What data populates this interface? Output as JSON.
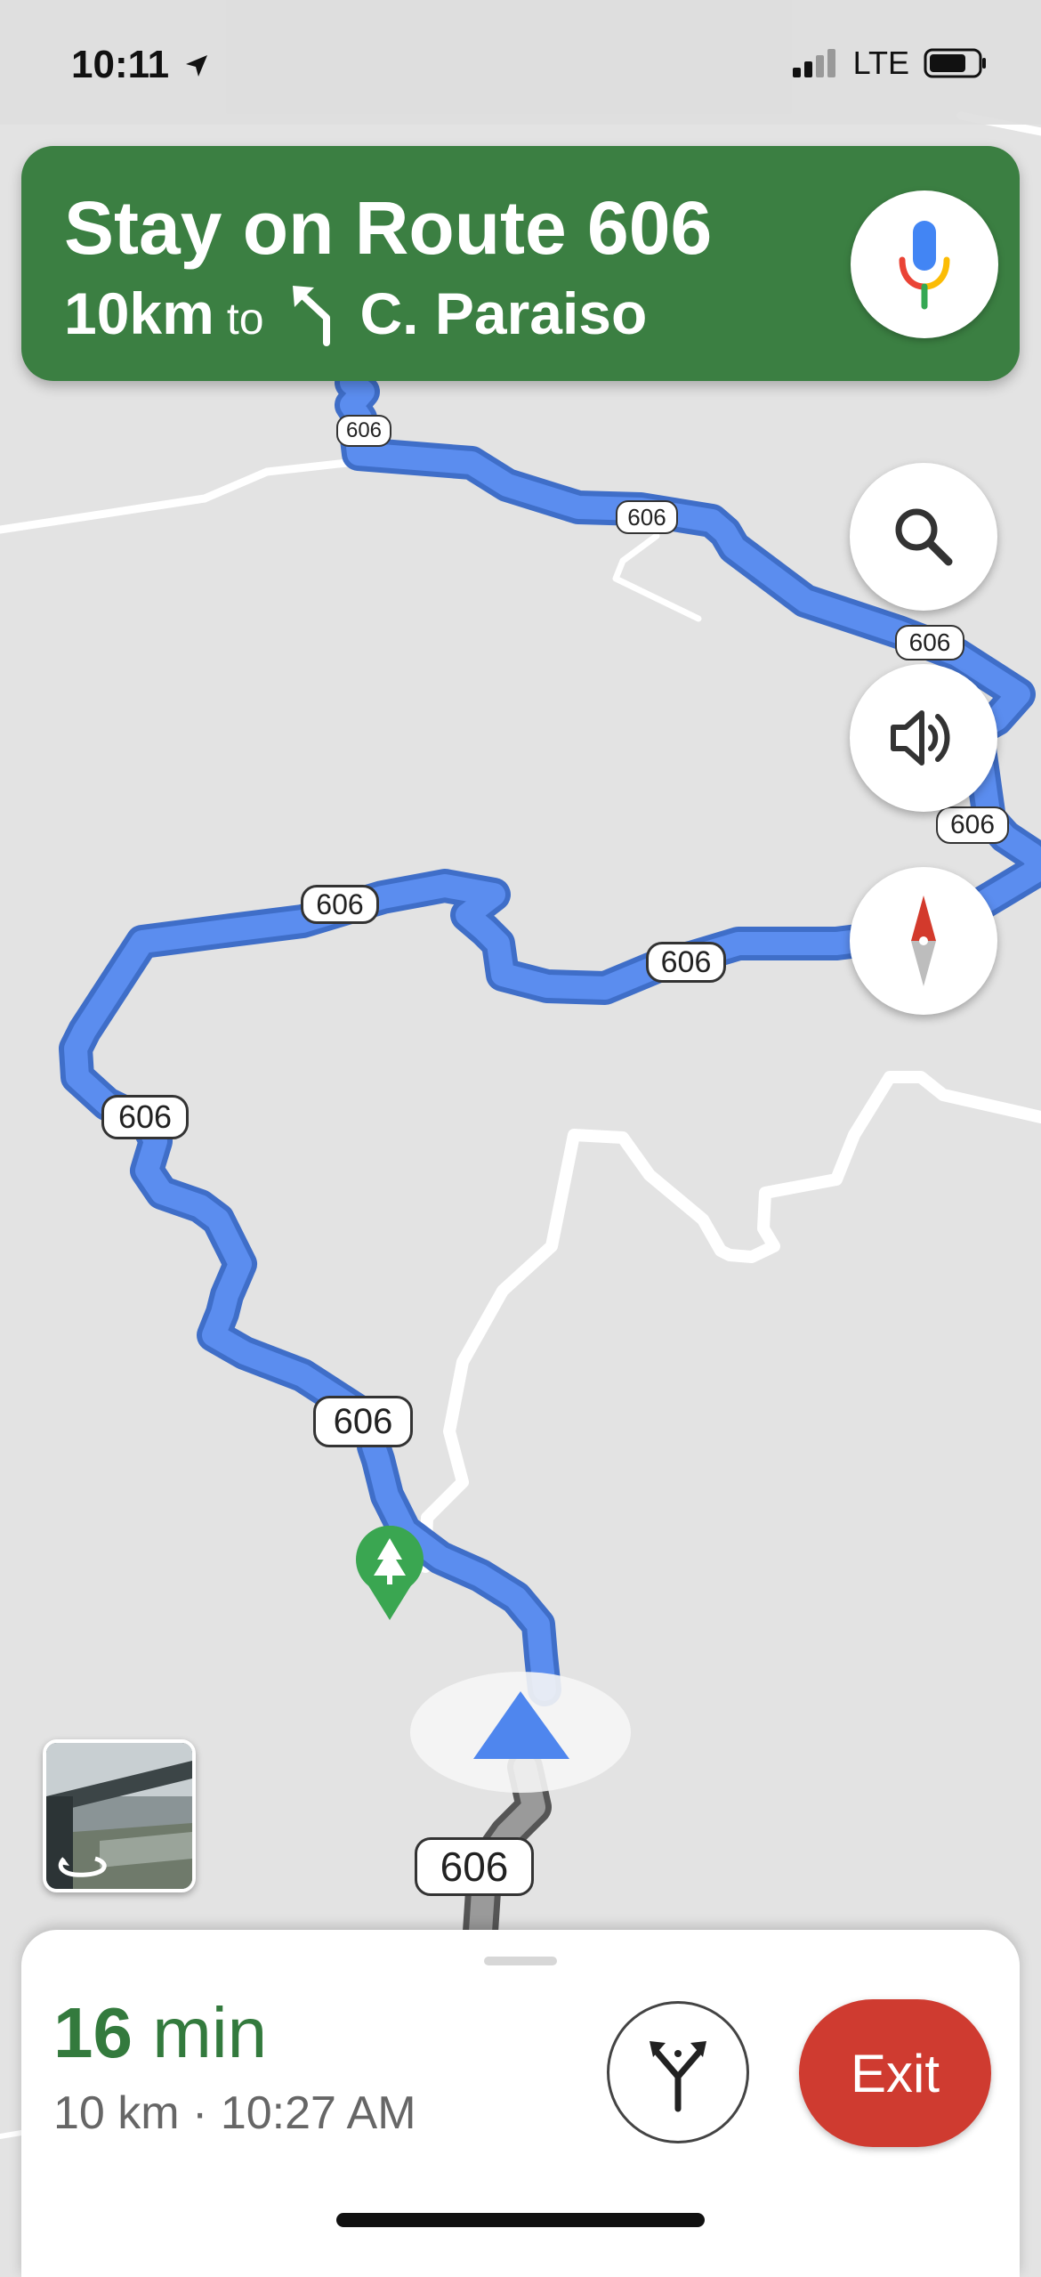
{
  "status_bar": {
    "time": "10:11",
    "network": "LTE"
  },
  "navigation": {
    "instruction": "Stay on Route 606",
    "distance": "10km",
    "to_word": "to",
    "street": "C. Paraiso",
    "turn_icon": "turn-slight-left-icon",
    "color": "#3b7f42"
  },
  "map": {
    "route_color": "#5b8def",
    "route_labels": [
      "606",
      "606",
      "606",
      "606",
      "606",
      "606",
      "606",
      "606",
      "606"
    ]
  },
  "controls": [
    "search-icon",
    "volume-icon",
    "compass-icon"
  ],
  "trip": {
    "eta_value": "16",
    "eta_unit": "min",
    "details": "10 km · 10:27 AM",
    "exit_label": "Exit",
    "eta_color": "#337a3d",
    "exit_color": "#cf3b30"
  }
}
